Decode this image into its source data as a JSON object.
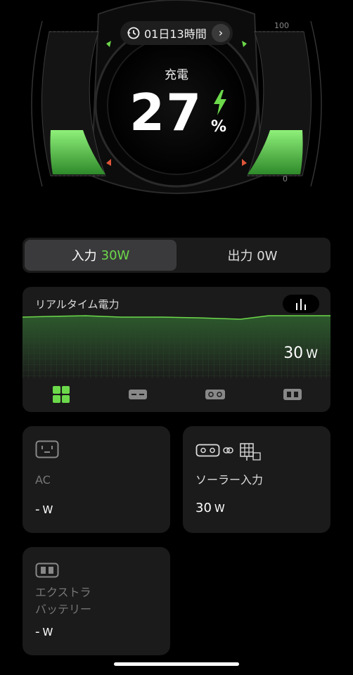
{
  "status": {
    "remaining_time": "01日13時間",
    "charge_label": "充電",
    "percent": "27",
    "percent_sign": "%",
    "scale_max": "100",
    "scale_min": "0",
    "battery_level": 0.27
  },
  "io_toggle": {
    "input_label": "入力",
    "input_value": "30W",
    "output_label": "出力 0W"
  },
  "realtime": {
    "title": "リアルタイム電力",
    "value": "30",
    "unit": "W",
    "tabs": [
      "all-icon",
      "ac-icon",
      "solar-icon",
      "extra-battery-icon"
    ]
  },
  "cards": {
    "ac": {
      "label": "AC",
      "value": "-",
      "unit": "W"
    },
    "solar": {
      "label": "ソーラー入力",
      "value": "30",
      "unit": "W"
    },
    "extra_battery": {
      "label_line1": "エクストラ",
      "label_line2": "バッテリー",
      "value": "-",
      "unit": "W"
    }
  },
  "colors": {
    "accent": "#6cd94b",
    "background": "#000000",
    "card": "#1b1b1b",
    "marker_red": "#e0553a"
  }
}
